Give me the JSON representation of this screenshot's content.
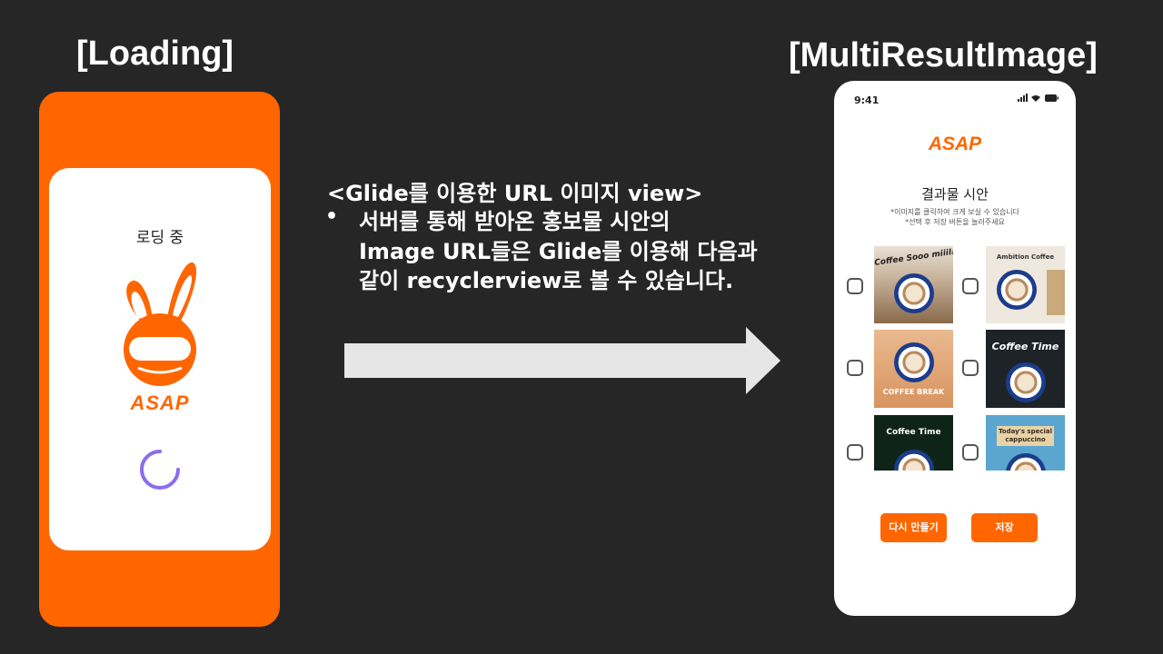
{
  "headings": {
    "loading": "[Loading]",
    "multi_result": "[MultiResultImage]"
  },
  "loading_screen": {
    "text": "로딩 중",
    "logo": "ASAP"
  },
  "description": {
    "title": "<Glide를 이용한 URL 이미지 view>",
    "bullet": "•",
    "lines": [
      "서버를 통해 받아온 홍보물 시안의",
      "Image URL들은 Glide를 이용해 다음과",
      "같이 recyclerview로 볼 수 있습니다."
    ]
  },
  "result_screen": {
    "status_time": "9:41",
    "logo": "ASAP",
    "title": "결과물 시안",
    "hint_1": "*이미지를 클릭하여 크게 보실 수 있습니다",
    "hint_2": "*선택 후 저장 버튼을 눌러주세요",
    "thumbnails": [
      {
        "label": "Coffee Sooo miiilk"
      },
      {
        "label": "Ambition Coffee"
      },
      {
        "label": "COFFEE BREAK"
      },
      {
        "label": "Coffee Time"
      },
      {
        "label": "Coffee Time"
      },
      {
        "label": "Today's special cappuccino"
      }
    ],
    "buttons": {
      "remake": "다시 만들기",
      "save": "저장"
    }
  },
  "colors": {
    "background": "#262626",
    "brand_orange": "#ff6600",
    "arrow": "#e6e6e6",
    "spinner": "#8a6cf0"
  }
}
